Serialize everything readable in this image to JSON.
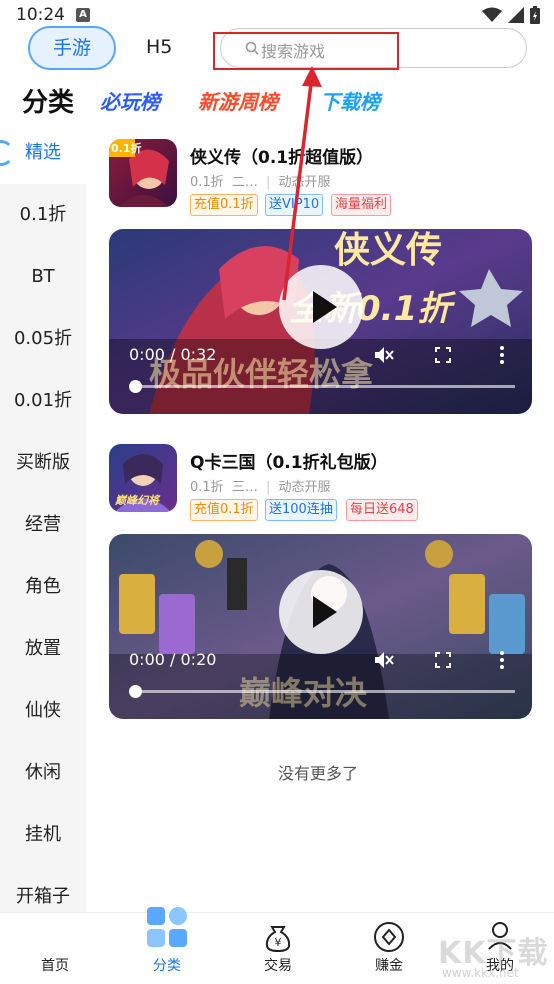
{
  "status_bar": {
    "time": "10:24",
    "notification_letter": "A"
  },
  "top_tabs": {
    "mobile": "手游",
    "h5": "H5"
  },
  "search": {
    "placeholder": "搜索游戏"
  },
  "category_header": {
    "title": "分类",
    "rank_tabs": [
      "必玩榜",
      "新游周榜",
      "下载榜"
    ]
  },
  "sidebar": {
    "items": [
      "精选",
      "0.1折",
      "BT",
      "0.05折",
      "0.01折",
      "买断版",
      "经营",
      "角色",
      "放置",
      "仙侠",
      "休闲",
      "挂机",
      "开箱子"
    ],
    "active_index": 0
  },
  "games": [
    {
      "name": "侠义传（0.1折超值版）",
      "meta_prefix": "0.1折",
      "meta_mid": "二…",
      "meta_tag": "动态开服",
      "tags": [
        "充值0.1折",
        "送VIP10",
        "海量福利"
      ],
      "video_time": "0:00 / 0:32",
      "icon_badge": "0.1折",
      "video_banner_1": "侠义传",
      "video_banner_2": "全新0.1折",
      "video_banner_3": "极品伙伴轻松拿"
    },
    {
      "name": "Q卡三国（0.1折礼包版）",
      "meta_prefix": "0.1折",
      "meta_mid": "三…",
      "meta_tag": "动态开服",
      "tags": [
        "充值0.1折",
        "送100连抽",
        "每日送648"
      ],
      "video_time": "0:00 / 0:20",
      "icon_caption": "巅峰幻将",
      "video_banner_3": "巅峰对决"
    }
  ],
  "footer": {
    "no_more": "没有更多了"
  },
  "bottom_nav": {
    "items": [
      "首页",
      "分类",
      "交易",
      "赚金",
      "我的"
    ],
    "active_index": 1
  },
  "watermark": {
    "main": "KK下载",
    "sub": "www.kkx.net"
  },
  "colors": {
    "accent": "#1a73e8",
    "highlight_red": "#d8262e",
    "tag_orange": "#f08a00",
    "tag_blue": "#1a73e8",
    "tag_red": "#e04444"
  }
}
